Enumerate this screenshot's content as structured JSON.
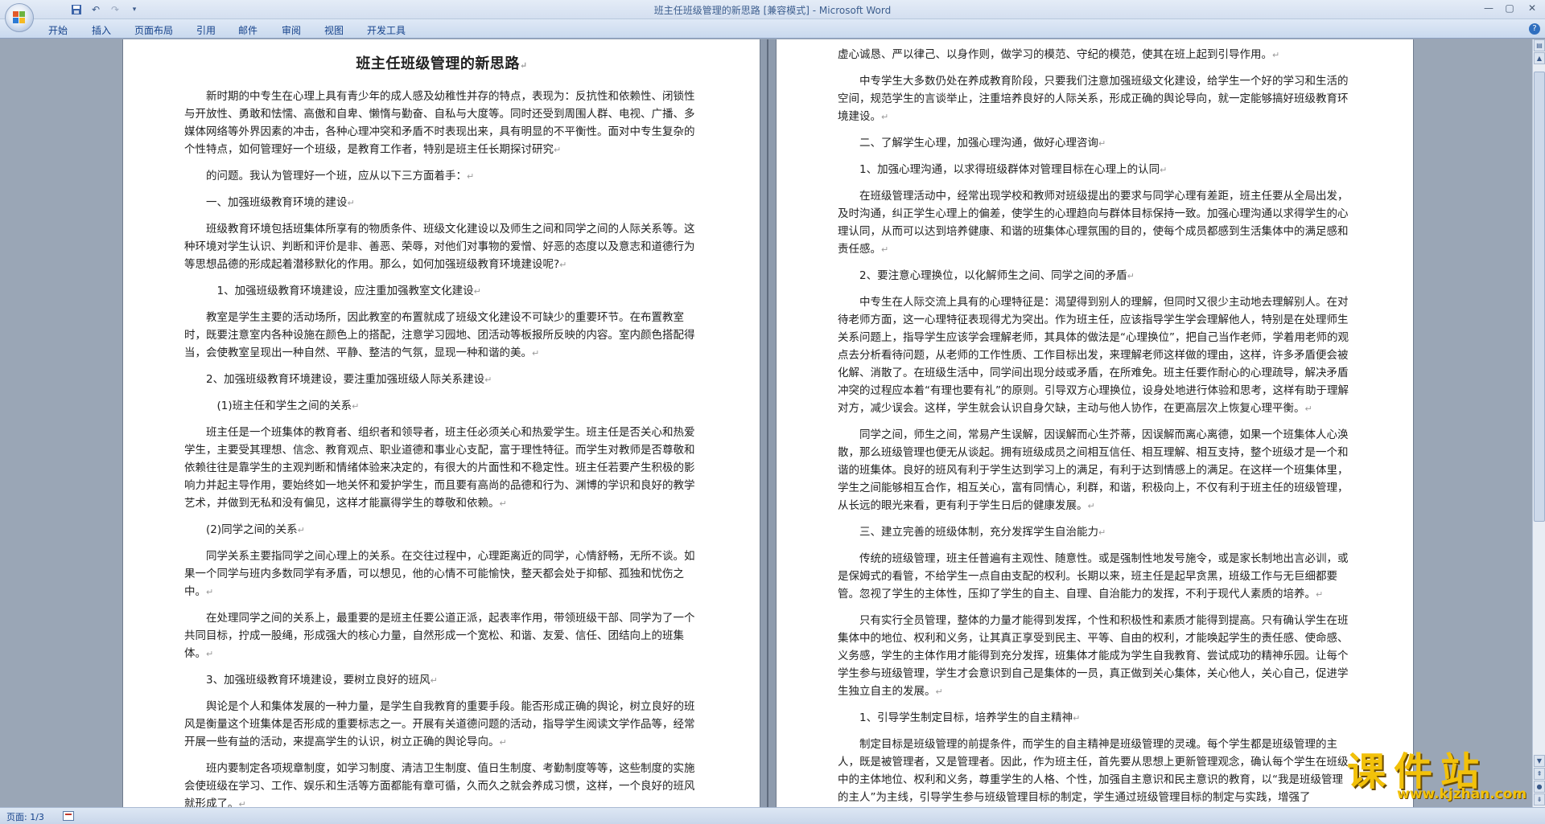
{
  "window": {
    "title": "班主任班级管理的新思路 [兼容模式] - Microsoft Word"
  },
  "qat": {
    "save_icon": "save-icon",
    "undo_icon": "undo-icon",
    "redo_icon": "redo-icon",
    "customize_icon": "customize-icon"
  },
  "ribbon": {
    "tabs": [
      "开始",
      "插入",
      "页面布局",
      "引用",
      "邮件",
      "审阅",
      "视图",
      "开发工具"
    ],
    "help_icon": "help-icon"
  },
  "page1": {
    "title": "班主任班级管理的新思路",
    "paragraphs": [
      "新时期的中专生在心理上具有青少年的成人感及幼稚性并存的特点，表现为：反抗性和依赖性、闭锁性与开放性、勇敢和怯懦、高傲和自卑、懒惰与勤奋、自私与大度等。同时还受到周围人群、电视、广播、多媒体网络等外界因素的冲击，各种心理冲突和矛盾不时表现出来，具有明显的不平衡性。面对中专生复杂的个性特点，如何管理好一个班级，是教育工作者，特别是班主任长期探讨研究",
      "的问题。我认为管理好一个班，应从以下三方面着手：",
      "一、加强班级教育环境的建设",
      "班级教育环境包括班集体所享有的物质条件、班级文化建设以及师生之间和同学之间的人际关系等。这种环境对学生认识、判断和评价是非、善恶、荣辱，对他们对事物的爱憎、好恶的态度以及意志和道德行为等思想品德的形成起着潜移默化的作用。那么，如何加强班级教育环境建设呢?",
      "1、加强班级教育环境建设，应注重加强教室文化建设",
      "教室是学生主要的活动场所，因此教室的布置就成了班级文化建设不可缺少的重要环节。在布置教室时，既要注意室内各种设施在颜色上的搭配，注意学习园地、团活动等板报所反映的内容。室内颜色搭配得当，会使教室呈现出一种自然、平静、整洁的气氛，显现一种和谐的美。",
      "2、加强班级教育环境建设，要注重加强班级人际关系建设",
      "(1)班主任和学生之间的关系",
      "班主任是一个班集体的教育者、组织者和领导者，班主任必须关心和热爱学生。班主任是否关心和热爱学生，主要受其理想、信念、教育观点、职业道德和事业心支配，富于理性特征。而学生对教师是否尊敬和依赖往往是靠学生的主观判断和情绪体验来决定的，有很大的片面性和不稳定性。班主任若要产生积极的影响力并起主导作用，要始终如一地关怀和爱护学生，而且要有高尚的品德和行为、渊博的学识和良好的教学艺术，并做到无私和没有偏见，这样才能赢得学生的尊敬和依赖。",
      "(2)同学之间的关系",
      "同学关系主要指同学之间心理上的关系。在交往过程中，心理距离近的同学，心情舒畅，无所不谈。如果一个同学与班内多数同学有矛盾，可以想见，他的心情不可能愉快，整天都会处于抑郁、孤独和忧伤之中。",
      "在处理同学之间的关系上，最重要的是班主任要公道正派，起表率作用，带领班级干部、同学为了一个共同目标，拧成一股绳，形成强大的核心力量，自然形成一个宽松、和谐、友爱、信任、团结向上的班集体。",
      "3、加强班级教育环境建设，要树立良好的班风",
      "舆论是个人和集体发展的一种力量，是学生自我教育的重要手段。能否形成正确的舆论，树立良好的班风是衡量这个班集体是否形成的重要标志之一。开展有关道德问题的活动，指导学生阅读文学作品等，经常开展一些有益的活动，来提高学生的认识，树立正确的舆论导向。",
      "班内要制定各项规章制度，如学习制度、清洁卫生制度、值日生制度、考勤制度等等，这些制度的实施会使班级在学习、工作、娱乐和生活等方面都能有章可循，久而久之就会养成习惯，这样，一个良好的班风就形成了。"
    ]
  },
  "page2": {
    "paragraphs": [
      "虚心诚恳、严以律己、以身作则，做学习的模范、守纪的模范，使其在班上起到引导作用。",
      "中专学生大多数仍处在养成教育阶段，只要我们注意加强班级文化建设，给学生一个好的学习和生活的空间，规范学生的言谈举止，注重培养良好的人际关系，形成正确的舆论导向，就一定能够搞好班级教育环境建设。",
      "二、了解学生心理，加强心理沟通，做好心理咨询",
      "1、加强心理沟通，以求得班级群体对管理目标在心理上的认同",
      "在班级管理活动中，经常出现学校和教师对班级提出的要求与同学心理有差距，班主任要从全局出发，及时沟通，纠正学生心理上的偏差，使学生的心理趋向与群体目标保持一致。加强心理沟通以求得学生的心理认同，从而可以达到培养健康、和谐的班集体心理氛围的目的，使每个成员都感到生活集体中的满足感和责任感。",
      "2、要注意心理换位，以化解师生之间、同学之间的矛盾",
      "中专生在人际交流上具有的心理特征是：渴望得到别人的理解，但同时又很少主动地去理解别人。在对待老师方面，这一心理特征表现得尤为突出。作为班主任，应该指导学生学会理解他人，特别是在处理师生关系问题上，指导学生应该学会理解老师，其具体的做法是“心理换位”，把自己当作老师，学着用老师的观点去分析看待问题，从老师的工作性质、工作目标出发，来理解老师这样做的理由，这样，许多矛盾便会被化解、消散了。在班级生活中，同学间出现分歧或矛盾，在所难免。班主任要作耐心的心理疏导，解决矛盾冲突的过程应本着“有理也要有礼”的原则。引导双方心理换位，设身处地进行体验和思考，这样有助于理解对方，减少误会。这样，学生就会认识自身欠缺，主动与他人协作，在更高层次上恢复心理平衡。",
      "同学之间，师生之间，常易产生误解，因误解而心生芥蒂，因误解而离心离德，如果一个班集体人心涣散，那么班级管理也便无从谈起。拥有班级成员之间相互信任、相互理解、相互支持，整个班级才是一个和谐的班集体。良好的班风有利于学生达到学习上的满足，有利于达到情感上的满足。在这样一个班集体里，学生之间能够相互合作，相互关心，富有同情心，利群，和谐，积极向上，不仅有利于班主任的班级管理，从长远的眼光来看，更有利于学生日后的健康发展。",
      "三、建立完善的班级体制，充分发挥学生自治能力",
      "传统的班级管理，班主任普遍有主观性、随意性。或是强制性地发号施令，或是家长制地出言必训，或是保姆式的看管，不给学生一点自由支配的权利。长期以来，班主任是起早贪黑，班级工作与无巨细都要管。忽视了学生的主体性，压抑了学生的自主、自理、自治能力的发挥，不利于现代人素质的培养。",
      "只有实行全员管理，整体的力量才能得到发挥，个性和积极性和素质才能得到提高。只有确认学生在班集体中的地位、权利和义务，让其真正享受到民主、平等、自由的权利，才能唤起学生的责任感、使命感、义务感，学生的主体作用才能得到充分发挥，班集体才能成为学生自我教育、尝试成功的精神乐园。让每个学生参与班级管理，学生才会意识到自己是集体的一员，真正做到关心集体，关心他人，关心自己，促进学生独立自主的发展。",
      "1、引导学生制定目标，培养学生的自主精神",
      "制定目标是班级管理的前提条件，而学生的自主精神是班级管理的灵魂。每个学生都是班级管理的主人，既是被管理者，又是管理者。因此，作为班主任，首先要从思想上更新管理观念，确认每个学生在班级中的主体地位、权利和义务，尊重学生的人格、个性，加强自主意识和民主意识的教育，以“我是班级管理的主人”为主线，引导学生参与班级管理目标的制定，学生通过班级管理目标的制定与实践，增强了"
    ]
  },
  "status": {
    "page": "页面: 1/3",
    "language_icon": "language-icon"
  },
  "watermark": {
    "text": "课件站",
    "url": "www.kjzhan.com"
  }
}
